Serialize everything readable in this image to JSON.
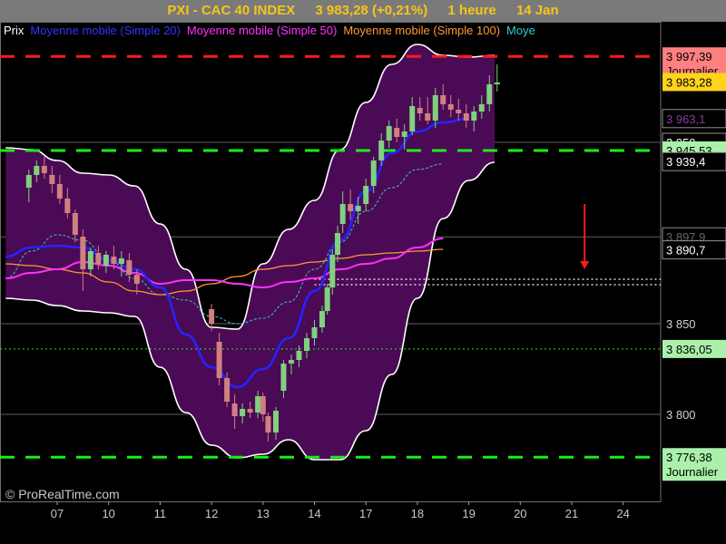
{
  "header": {
    "instrument": "PXI - CAC 40 INDEX",
    "price_change": "3 983,28 (+0,21%)",
    "timeframe": "1 heure",
    "date": "14 Jan"
  },
  "legend": [
    {
      "label": "Prix",
      "color": "#ffffff"
    },
    {
      "label": "Moyenne mobile (Simple 20)",
      "color": "#3333ff"
    },
    {
      "label": "Moyenne mobile (Simple 50)",
      "color": "#ff33ff"
    },
    {
      "label": "Moyenne mobile (Simple 100)",
      "color": "#ff9933"
    },
    {
      "label": "Moye",
      "color": "#33cccc"
    }
  ],
  "watermark": "© ProRealTime.com",
  "colors": {
    "background": "#000000",
    "band_fill": "#4b0a55",
    "band_border": "#ffffff",
    "candle_up": "#80d080",
    "candle_down": "#d08080",
    "resistance": "#ff1a1a",
    "support": "#18ee18",
    "arrow": "#ff1a1a",
    "ma20": "#2424ff",
    "ma50": "#ff30ff",
    "ma100": "#ff9a30",
    "ma200": "#38c8c8"
  },
  "chart_data": {
    "type": "candlestick",
    "y_range": [
      3768,
      4012
    ],
    "x_range": [
      6.5,
      25
    ],
    "x_tick_labels": [
      "07",
      "10",
      "11",
      "12",
      "13",
      "14",
      "17",
      "18",
      "19",
      "20",
      "21",
      "24"
    ],
    "y_tick_labels": [
      {
        "value": 3850,
        "label": "3 850"
      },
      {
        "value": 3800,
        "label": "3 800"
      }
    ],
    "level_lines": [
      {
        "value": 3997.39,
        "style": "red-dash"
      },
      {
        "value": 3945.53,
        "style": "green-dash"
      },
      {
        "value": 3836.05,
        "style": "green-dot"
      },
      {
        "value": 3776.38,
        "style": "green-dash"
      },
      {
        "value": 3871.5,
        "style": "white-dot"
      },
      {
        "value": 3874.5,
        "style": "white-dot"
      }
    ],
    "price_tags": [
      {
        "value": 3997.39,
        "text": "3 997,39",
        "sub": "Journalier",
        "bg": "#ff8080",
        "fg": "#000000"
      },
      {
        "value": 3983.28,
        "text": "3 983,28",
        "sub": "",
        "bg": "#ffd31c",
        "fg": "#000000"
      },
      {
        "value": 3963.1,
        "text": "3 963,1",
        "sub": "",
        "bg": "#000000",
        "fg": "#8a3aa0"
      },
      {
        "value": 3950,
        "text": "3 950",
        "sub": "",
        "bg": "#000000",
        "fg": "#ffffff"
      },
      {
        "value": 3945.53,
        "text": "3 945,53",
        "sub": "",
        "bg": "#aaf0aa",
        "fg": "#000000"
      },
      {
        "value": 3939.4,
        "text": "3 939,4",
        "sub": "",
        "bg": "#000000",
        "fg": "#ffffff"
      },
      {
        "value": 3897.9,
        "text": "3 897,9",
        "sub": "",
        "bg": "#000000",
        "fg": "#666666"
      },
      {
        "value": 3890.7,
        "text": "3 890,7",
        "sub": "",
        "bg": "#000000",
        "fg": "#ffffff"
      },
      {
        "value": 3836.05,
        "text": "3 836,05",
        "sub": "",
        "bg": "#aaf0aa",
        "fg": "#000000"
      },
      {
        "value": 3776.38,
        "text": "3 776,38",
        "sub": "Journalier",
        "bg": "#aaf0aa",
        "fg": "#000000"
      }
    ],
    "arrow": {
      "x": 17.25,
      "from": 3916,
      "to": 3880
    },
    "candles": [
      [
        6.45,
        3925,
        3935,
        3917,
        3932
      ],
      [
        6.6,
        3932,
        3940,
        3928,
        3937
      ],
      [
        6.75,
        3937,
        3942,
        3930,
        3933
      ],
      [
        6.9,
        3932,
        3937,
        3922,
        3927
      ],
      [
        7.05,
        3927,
        3932,
        3916,
        3919
      ],
      [
        7.2,
        3919,
        3925,
        3908,
        3911
      ],
      [
        7.35,
        3911,
        3913,
        3895,
        3899
      ],
      [
        7.5,
        3898,
        3902,
        3868,
        3880
      ],
      [
        7.65,
        3880,
        3892,
        3876,
        3890
      ],
      [
        7.8,
        3889,
        3893,
        3880,
        3883
      ],
      [
        7.95,
        3882,
        3890,
        3878,
        3888
      ],
      [
        8.1,
        3887,
        3893,
        3880,
        3883
      ],
      [
        8.25,
        3883,
        3890,
        3876,
        3886
      ],
      [
        8.4,
        3885,
        3889,
        3873,
        3877
      ],
      [
        8.55,
        3877,
        3880,
        3866,
        3872
      ],
      [
        10.0,
        3858,
        3861,
        3846,
        3850
      ],
      [
        10.15,
        3840,
        3845,
        3816,
        3820
      ],
      [
        10.3,
        3820,
        3823,
        3804,
        3807
      ],
      [
        10.45,
        3806,
        3811,
        3792,
        3799
      ],
      [
        10.6,
        3799,
        3806,
        3795,
        3803
      ],
      [
        10.75,
        3803,
        3807,
        3798,
        3801
      ],
      [
        10.9,
        3801,
        3813,
        3798,
        3810
      ],
      [
        11.0,
        3810,
        3812,
        3796,
        3800
      ],
      [
        11.1,
        3799,
        3801,
        3785,
        3790
      ],
      [
        11.25,
        3790,
        3804,
        3786,
        3802
      ],
      [
        11.4,
        3813,
        3830,
        3809,
        3828
      ],
      [
        11.55,
        3828,
        3833,
        3822,
        3830
      ],
      [
        11.7,
        3830,
        3838,
        3826,
        3835
      ],
      [
        11.85,
        3835,
        3845,
        3831,
        3842
      ],
      [
        12.0,
        3842,
        3852,
        3838,
        3848
      ],
      [
        12.15,
        3848,
        3860,
        3845,
        3857
      ],
      [
        12.25,
        3857,
        3872,
        3855,
        3870
      ],
      [
        12.35,
        3870,
        3891,
        3866,
        3888
      ],
      [
        12.45,
        3888,
        3904,
        3884,
        3900
      ],
      [
        12.55,
        3905,
        3923,
        3900,
        3916
      ],
      [
        12.7,
        3916,
        3924,
        3907,
        3912
      ],
      [
        12.85,
        3912,
        3920,
        3905,
        3915
      ],
      [
        13.0,
        3916,
        3930,
        3912,
        3926
      ],
      [
        13.15,
        3926,
        3942,
        3922,
        3940
      ],
      [
        13.3,
        3940,
        3955,
        3937,
        3951
      ],
      [
        13.45,
        3951,
        3962,
        3947,
        3959
      ],
      [
        13.6,
        3958,
        3963,
        3950,
        3953
      ],
      [
        13.75,
        3953,
        3960,
        3946,
        3956
      ],
      [
        13.9,
        3956,
        3975,
        3954,
        3970
      ],
      [
        14.05,
        3969,
        3975,
        3962,
        3966
      ],
      [
        14.2,
        3966,
        3975,
        3960,
        3962
      ],
      [
        14.35,
        3962,
        3980,
        3958,
        3976
      ],
      [
        14.5,
        3976,
        3982,
        3968,
        3971
      ],
      [
        14.65,
        3971,
        3976,
        3964,
        3968
      ],
      [
        14.8,
        3968,
        3974,
        3962,
        3966
      ],
      [
        14.95,
        3966,
        3971,
        3958,
        3962
      ],
      [
        15.1,
        3962,
        3970,
        3956,
        3967
      ],
      [
        15.25,
        3967,
        3976,
        3963,
        3971
      ],
      [
        15.4,
        3971,
        3987,
        3967,
        3982
      ],
      [
        15.55,
        3982,
        3993,
        3978,
        3983
      ]
    ],
    "bollinger_upper": [
      [
        6.0,
        3947
      ],
      [
        6.5,
        3946
      ],
      [
        7.0,
        3940
      ],
      [
        7.5,
        3933
      ],
      [
        8.0,
        3932
      ],
      [
        8.5,
        3926
      ],
      [
        9.0,
        3905
      ],
      [
        9.5,
        3880
      ],
      [
        10.0,
        3848
      ],
      [
        10.5,
        3847
      ],
      [
        11.0,
        3883
      ],
      [
        11.5,
        3902
      ],
      [
        12.0,
        3918
      ],
      [
        12.5,
        3946
      ],
      [
        13.0,
        3972
      ],
      [
        13.5,
        3993
      ],
      [
        14.0,
        4004
      ],
      [
        14.5,
        3998
      ],
      [
        15.0,
        3997
      ],
      [
        15.5,
        3998
      ]
    ],
    "bollinger_lower": [
      [
        6.0,
        3864
      ],
      [
        6.5,
        3863
      ],
      [
        7.0,
        3860
      ],
      [
        7.5,
        3857
      ],
      [
        8.0,
        3856
      ],
      [
        8.5,
        3854
      ],
      [
        9.0,
        3826
      ],
      [
        9.5,
        3801
      ],
      [
        10.0,
        3783
      ],
      [
        10.5,
        3776
      ],
      [
        11.0,
        3778
      ],
      [
        11.5,
        3786
      ],
      [
        12.0,
        3775
      ],
      [
        12.5,
        3775
      ],
      [
        13.0,
        3791
      ],
      [
        13.5,
        3822
      ],
      [
        14.0,
        3864
      ],
      [
        14.5,
        3908
      ],
      [
        15.0,
        3929
      ],
      [
        15.5,
        3939
      ]
    ],
    "ma20": [
      [
        6.0,
        3887
      ],
      [
        6.5,
        3892
      ],
      [
        7.0,
        3893
      ],
      [
        7.5,
        3892
      ],
      [
        8.0,
        3885
      ],
      [
        8.5,
        3880
      ],
      [
        9.0,
        3870
      ],
      [
        9.5,
        3844
      ],
      [
        10.0,
        3826
      ],
      [
        10.5,
        3815
      ],
      [
        11.0,
        3825
      ],
      [
        11.5,
        3842
      ],
      [
        12.0,
        3868
      ],
      [
        12.5,
        3896
      ],
      [
        13.0,
        3923
      ],
      [
        13.5,
        3944
      ],
      [
        14.0,
        3956
      ],
      [
        14.5,
        3961
      ],
      [
        15.0,
        3963
      ]
    ],
    "ma50": [
      [
        6.0,
        3875
      ],
      [
        6.5,
        3878
      ],
      [
        7.0,
        3880
      ],
      [
        7.5,
        3884
      ],
      [
        8.0,
        3882
      ],
      [
        8.5,
        3878
      ],
      [
        9.0,
        3872
      ],
      [
        9.5,
        3874
      ],
      [
        10.0,
        3874
      ],
      [
        10.5,
        3872
      ],
      [
        11.0,
        3870
      ],
      [
        11.5,
        3873
      ],
      [
        12.0,
        3875
      ],
      [
        12.5,
        3880
      ],
      [
        13.0,
        3883
      ],
      [
        13.5,
        3886
      ],
      [
        14.0,
        3892
      ],
      [
        14.5,
        3897
      ]
    ],
    "ma100": [
      [
        6.0,
        3883
      ],
      [
        6.5,
        3882
      ],
      [
        7.0,
        3880
      ],
      [
        7.5,
        3878
      ],
      [
        8.0,
        3873
      ],
      [
        8.5,
        3868
      ],
      [
        9.0,
        3866
      ],
      [
        9.5,
        3868
      ],
      [
        10.0,
        3872
      ],
      [
        10.5,
        3876
      ],
      [
        11.0,
        3880
      ],
      [
        11.5,
        3882
      ],
      [
        12.0,
        3884
      ],
      [
        12.5,
        3886
      ],
      [
        13.0,
        3888
      ],
      [
        13.5,
        3889
      ],
      [
        14.0,
        3890
      ],
      [
        14.5,
        3891
      ]
    ],
    "ma200": [
      [
        6.0,
        3875
      ],
      [
        6.5,
        3890
      ],
      [
        7.0,
        3899
      ],
      [
        7.5,
        3896
      ],
      [
        8.0,
        3885
      ],
      [
        8.5,
        3875
      ],
      [
        9.0,
        3866
      ],
      [
        9.5,
        3863
      ],
      [
        10.0,
        3854
      ],
      [
        10.5,
        3850
      ],
      [
        11.0,
        3853
      ],
      [
        11.5,
        3862
      ],
      [
        12.0,
        3880
      ],
      [
        12.5,
        3895
      ],
      [
        13.0,
        3912
      ],
      [
        13.5,
        3925
      ],
      [
        14.0,
        3935
      ],
      [
        14.5,
        3938
      ]
    ]
  }
}
